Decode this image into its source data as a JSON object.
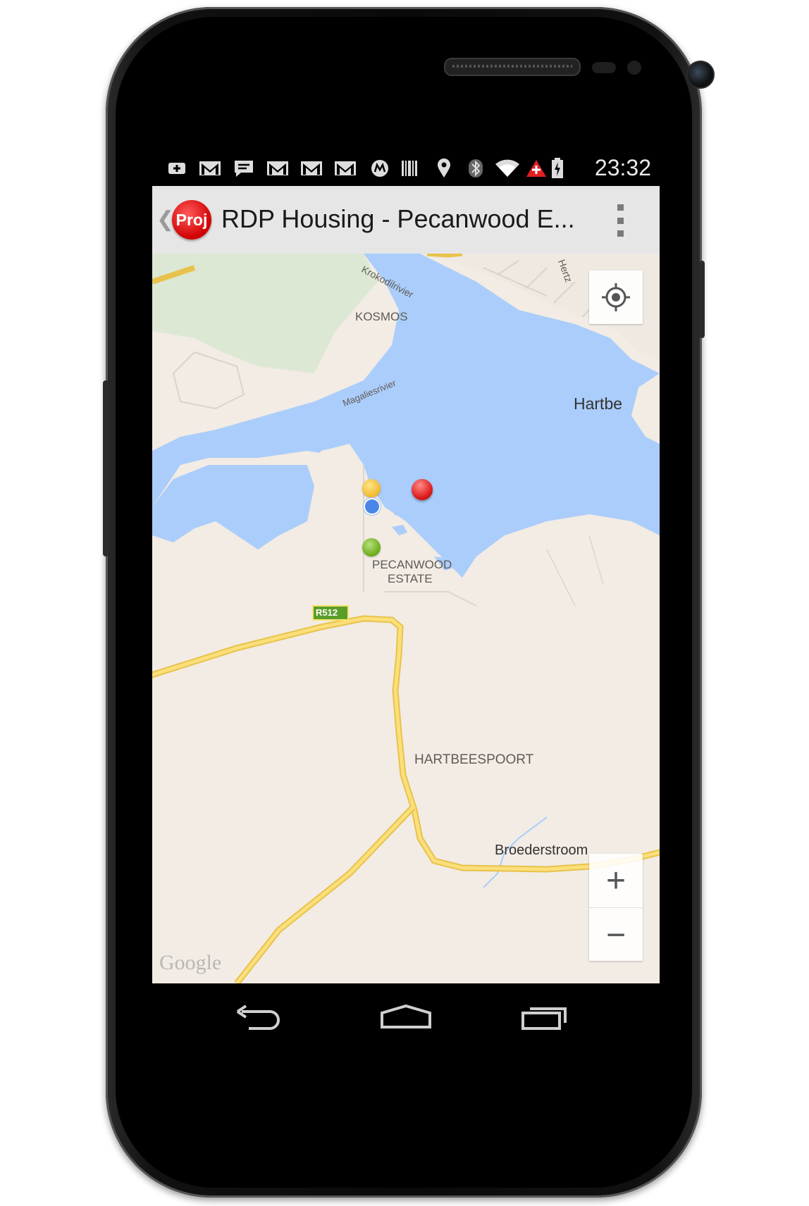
{
  "status_bar": {
    "time": "23:32",
    "icons": [
      "plus-notification-icon",
      "gmail-icon",
      "chat-icon",
      "gmail-icon",
      "gmail-icon",
      "gmail-icon",
      "motorola-icon",
      "barcode-icon",
      "location-icon",
      "bluetooth-icon",
      "wifi-icon",
      "alert-icon",
      "battery-charging-icon"
    ]
  },
  "action_bar": {
    "logo_text": "Proj",
    "title": "RDP Housing - Pecanwood E...",
    "back_icon": "chevron-left-icon",
    "menu_icon": "overflow-menu-icon"
  },
  "map": {
    "labels": {
      "krokodilrivier": "Krokodilrivier",
      "hertz": "Hertz",
      "kosmos": "KOSMOS",
      "magaliesrivier": "Magaliesrivier",
      "hartbe": "Hartbe",
      "pecanwood_line1": "PECANWOOD",
      "pecanwood_line2": "ESTATE",
      "road_r512": "R512",
      "hartbeespoort": "HARTBEESPOORT",
      "broederstroom": "Broederstroom",
      "google": "Google"
    },
    "controls": {
      "locate_icon": "my-location-icon",
      "zoom_in": "+",
      "zoom_out": "−"
    },
    "markers": [
      {
        "name": "yellow-marker",
        "color": "#f7c948"
      },
      {
        "name": "blue-location-dot",
        "color": "#4a86e8"
      },
      {
        "name": "red-marker",
        "color": "#e02020"
      },
      {
        "name": "green-marker",
        "color": "#6aaa1a"
      }
    ]
  },
  "nav_bar": {
    "back": "back-icon",
    "home": "home-icon",
    "recents": "recent-apps-icon"
  }
}
